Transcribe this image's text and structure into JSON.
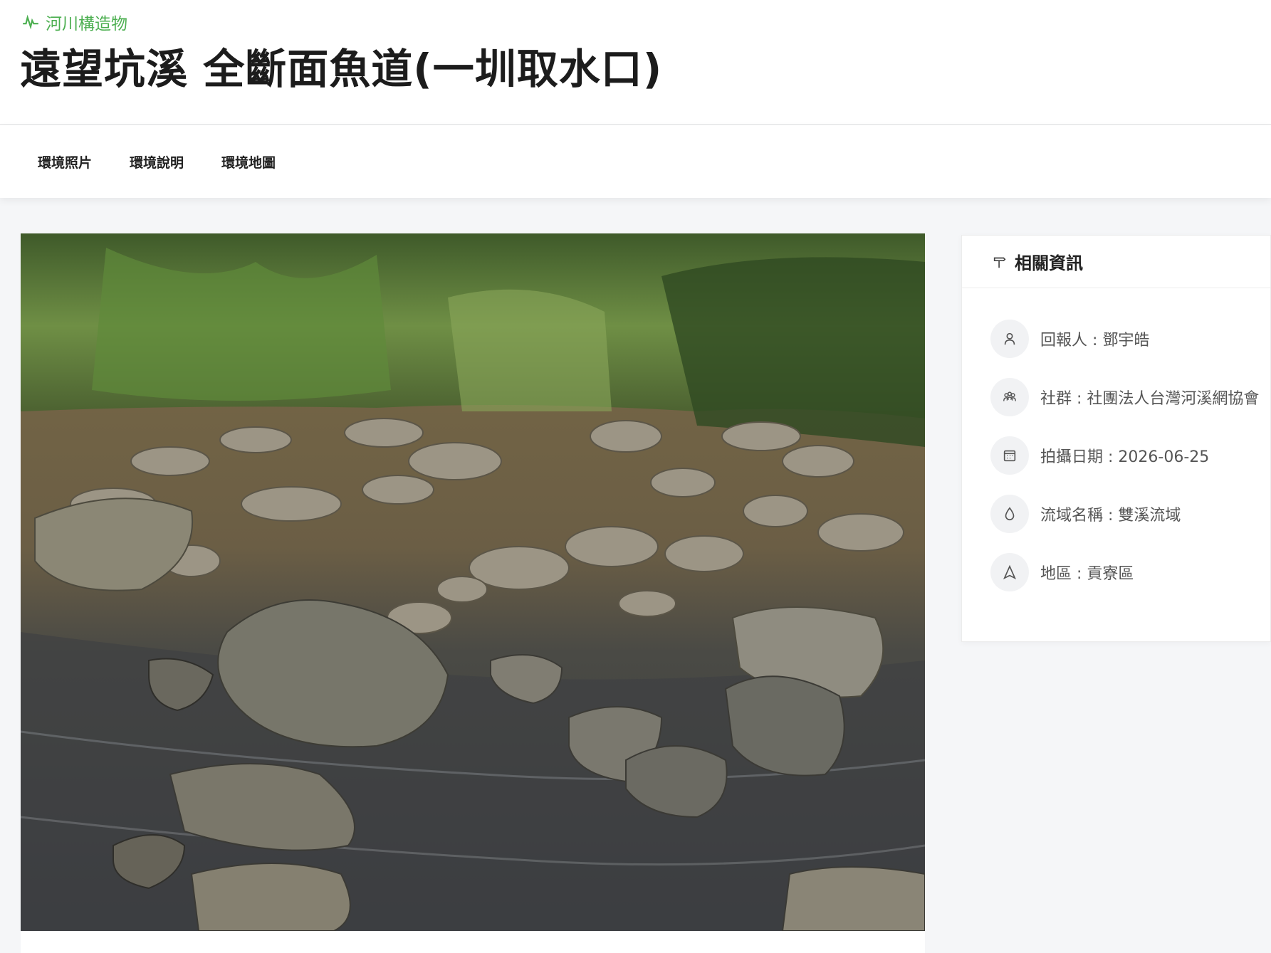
{
  "header": {
    "category": "河川構造物",
    "title": "遠望坑溪 全斷面魚道(一圳取水口)"
  },
  "tabs": [
    {
      "label": "環境照片"
    },
    {
      "label": "環境說明"
    },
    {
      "label": "環境地圖"
    }
  ],
  "info": {
    "title": "相關資訊",
    "items": [
      {
        "icon": "user-icon",
        "text": "回報人 : 鄧宇皓"
      },
      {
        "icon": "group-icon",
        "text": "社群 : 社團法人台灣河溪網協會"
      },
      {
        "icon": "calendar-icon",
        "text": "拍攝日期 : 2026-06-25"
      },
      {
        "icon": "water-drop-icon",
        "text": "流域名稱 : 雙溪流域"
      },
      {
        "icon": "location-icon",
        "text": "地區 : 貢寮區"
      }
    ]
  },
  "colors": {
    "accent": "#4caf50",
    "icon_bg": "#f1f2f4"
  }
}
